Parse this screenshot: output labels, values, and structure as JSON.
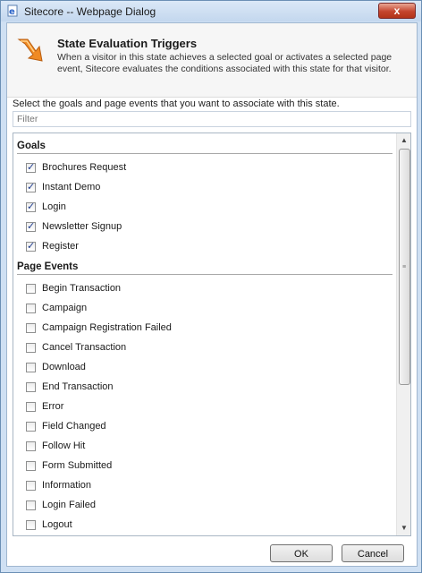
{
  "window": {
    "title": "Sitecore -- Webpage Dialog",
    "close_label": "x"
  },
  "header": {
    "title": "State Evaluation Triggers",
    "description": "When a visitor in this state achieves a selected goal or activates a selected page event, Sitecore evaluates the conditions associated with this state for that visitor."
  },
  "instruction": "Select the goals and page events that you want to associate with this state.",
  "filter": {
    "placeholder": "Filter",
    "value": ""
  },
  "sections": [
    {
      "title": "Goals",
      "items": [
        {
          "label": "Brochures Request",
          "checked": true
        },
        {
          "label": "Instant Demo",
          "checked": true
        },
        {
          "label": "Login",
          "checked": true
        },
        {
          "label": "Newsletter Signup",
          "checked": true
        },
        {
          "label": "Register",
          "checked": true
        }
      ]
    },
    {
      "title": "Page Events",
      "items": [
        {
          "label": "Begin Transaction",
          "checked": false
        },
        {
          "label": "Campaign",
          "checked": false
        },
        {
          "label": "Campaign Registration Failed",
          "checked": false
        },
        {
          "label": "Cancel Transaction",
          "checked": false
        },
        {
          "label": "Download",
          "checked": false
        },
        {
          "label": "End Transaction",
          "checked": false
        },
        {
          "label": "Error",
          "checked": false
        },
        {
          "label": "Field Changed",
          "checked": false
        },
        {
          "label": "Follow Hit",
          "checked": false
        },
        {
          "label": "Form Submitted",
          "checked": false
        },
        {
          "label": "Information",
          "checked": false
        },
        {
          "label": "Login Failed",
          "checked": false
        },
        {
          "label": "Logout",
          "checked": false
        },
        {
          "label": "",
          "checked": false
        }
      ]
    }
  ],
  "buttons": {
    "ok": "OK",
    "cancel": "Cancel"
  },
  "icons": {
    "window": "ie-page-icon",
    "header": "trigger-arrow-icon",
    "scroll_up": "scroll-up-arrow-icon",
    "scroll_down": "scroll-down-arrow-icon"
  },
  "colors": {
    "frame": "#cfe0f3",
    "close_button": "#c4452e",
    "header_icon": "#f08a24",
    "checkmark": "#1d3b8e"
  }
}
